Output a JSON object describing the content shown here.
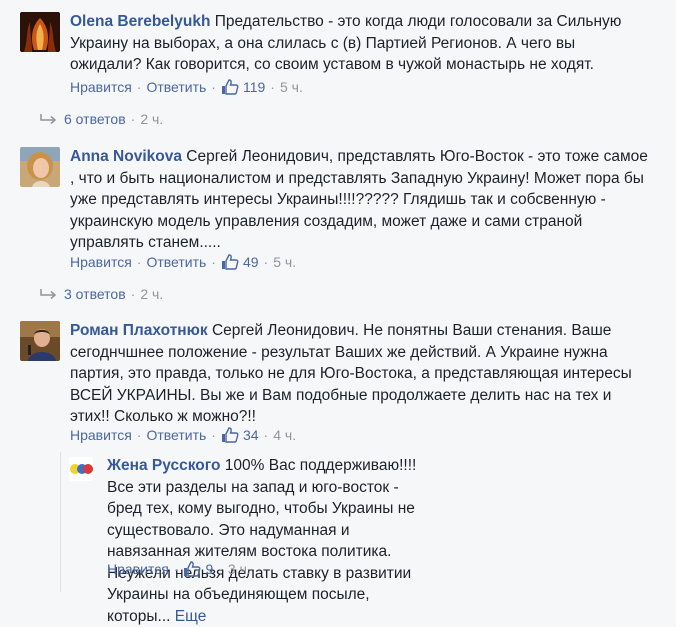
{
  "comments": [
    {
      "author": "Olena Berebelyukh",
      "text": "Предательство - это когда люди голосовали за Сильную Украину на выборах, а она слилась с (в) Партией Регионов. А чего вы ожидали? Как говорится, со своим уставом в чужой монастырь не ходят.",
      "like_label": "Нравится",
      "reply_label": "Ответить",
      "likes": "119",
      "time": "5 ч.",
      "replies_label": "6 ответов",
      "replies_time": "2 ч."
    },
    {
      "author": "Anna Novikova",
      "text": "Сергей Леонидович, представлять Юго-Восток - это тоже самое , что и быть националистом и представлять Западную Украину! Может пора бы уже представлять интересы Украины!!!!????? Глядишь так и собсвенную - украинскую модель управления создадим, может даже и сами страной управлять станем.....",
      "like_label": "Нравится",
      "reply_label": "Ответить",
      "likes": "49",
      "time": "5 ч.",
      "replies_label": "3 ответов",
      "replies_time": "2 ч."
    },
    {
      "author": "Роман Плахотнюк",
      "text": "Сергей Леонидович. Не понятны Ваши стенания. Ваше сегоднчшнее положение - результат Ваших же действий. А Украине нужна партия, это правда, только не для Юго-Востока, а представляющая интересы ВСЕЙ УКРАИНЫ. Вы же и Вам подобные продолжаете делить нас на тех и этих!! Сколько ж можно?!!",
      "like_label": "Нравится",
      "reply_label": "Ответить",
      "likes": "34",
      "time": "4 ч."
    }
  ],
  "reply": {
    "author": "Жена Русского",
    "text": "100% Вас поддерживаю!!!! Все эти разделы на запад и юго-восток - бред тех, кому выгодно, чтобы Украины не существовало. Это надуманная и навязанная жителям востока политика. Неужели нельзя делать ставку в развитии Украины на объединяющем посыле, которы...",
    "more_label": "Еще",
    "like_label": "Нравится",
    "likes": "9",
    "time": "3 ч."
  },
  "colors": {
    "link": "#365899",
    "meta": "#90949c",
    "background": "#f6f7f9"
  },
  "icons": [
    "thumbs-up-icon",
    "reply-arrow-icon"
  ]
}
